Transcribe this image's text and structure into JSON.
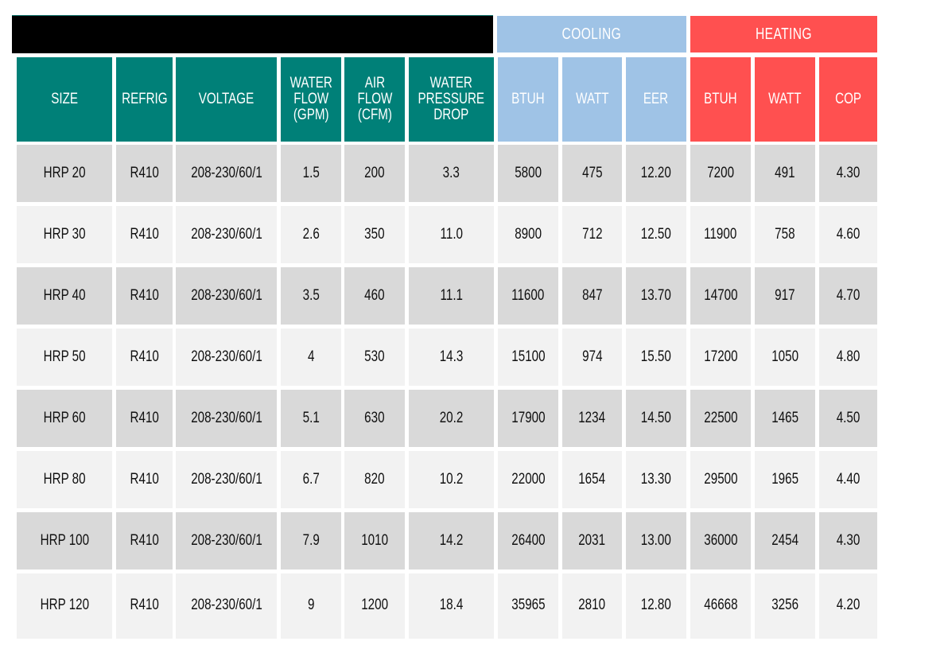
{
  "table": {
    "group_headers": {
      "blank": "",
      "cooling": "COOLING",
      "heating": "HEATING"
    },
    "columns": [
      {
        "label": "SIZE",
        "group": "spec"
      },
      {
        "label": "REFRIG",
        "group": "spec"
      },
      {
        "label": "VOLTAGE",
        "group": "spec"
      },
      {
        "label": "WATER\nFLOW\n(GPM)",
        "group": "spec"
      },
      {
        "label": "AIR\nFLOW\n(CFM)",
        "group": "spec"
      },
      {
        "label": "WATER\nPRESSURE\nDROP",
        "group": "spec"
      },
      {
        "label": "BTUH",
        "group": "cooling"
      },
      {
        "label": "WATT",
        "group": "cooling"
      },
      {
        "label": "EER",
        "group": "cooling"
      },
      {
        "label": "BTUH",
        "group": "heating"
      },
      {
        "label": "WATT",
        "group": "heating"
      },
      {
        "label": "COP",
        "group": "heating"
      }
    ],
    "rows": [
      [
        "HRP 20",
        "R410",
        "208-230/60/1",
        "1.5",
        "200",
        "3.3",
        "5800",
        "475",
        "12.20",
        "7200",
        "491",
        "4.30"
      ],
      [
        "HRP 30",
        "R410",
        "208-230/60/1",
        "2.6",
        "350",
        "11.0",
        "8900",
        "712",
        "12.50",
        "11900",
        "758",
        "4.60"
      ],
      [
        "HRP 40",
        "R410",
        "208-230/60/1",
        "3.5",
        "460",
        "11.1",
        "11600",
        "847",
        "13.70",
        "14700",
        "917",
        "4.70"
      ],
      [
        "HRP 50",
        "R410",
        "208-230/60/1",
        "4",
        "530",
        "14.3",
        "15100",
        "974",
        "15.50",
        "17200",
        "1050",
        "4.80"
      ],
      [
        "HRP 60",
        "R410",
        "208-230/60/1",
        "5.1",
        "630",
        "20.2",
        "17900",
        "1234",
        "14.50",
        "22500",
        "1465",
        "4.50"
      ],
      [
        "HRP 80",
        "R410",
        "208-230/60/1",
        "6.7",
        "820",
        "10.2",
        "22000",
        "1654",
        "13.30",
        "29500",
        "1965",
        "4.40"
      ],
      [
        "HRP 100",
        "R410",
        "208-230/60/1",
        "7.9",
        "1010",
        "14.2",
        "26400",
        "2031",
        "13.00",
        "36000",
        "2454",
        "4.30"
      ],
      [
        "HRP 120",
        "R410",
        "208-230/60/1",
        "9",
        "1200",
        "18.4",
        "35965",
        "2810",
        "12.80",
        "46668",
        "3256",
        "4.20"
      ]
    ]
  },
  "colors": {
    "spec_header": "#008078",
    "cooling": "#9fc3e6",
    "heating": "#ff5050",
    "row_dark": "#d9d9d9",
    "row_light": "#f2f2f2"
  }
}
